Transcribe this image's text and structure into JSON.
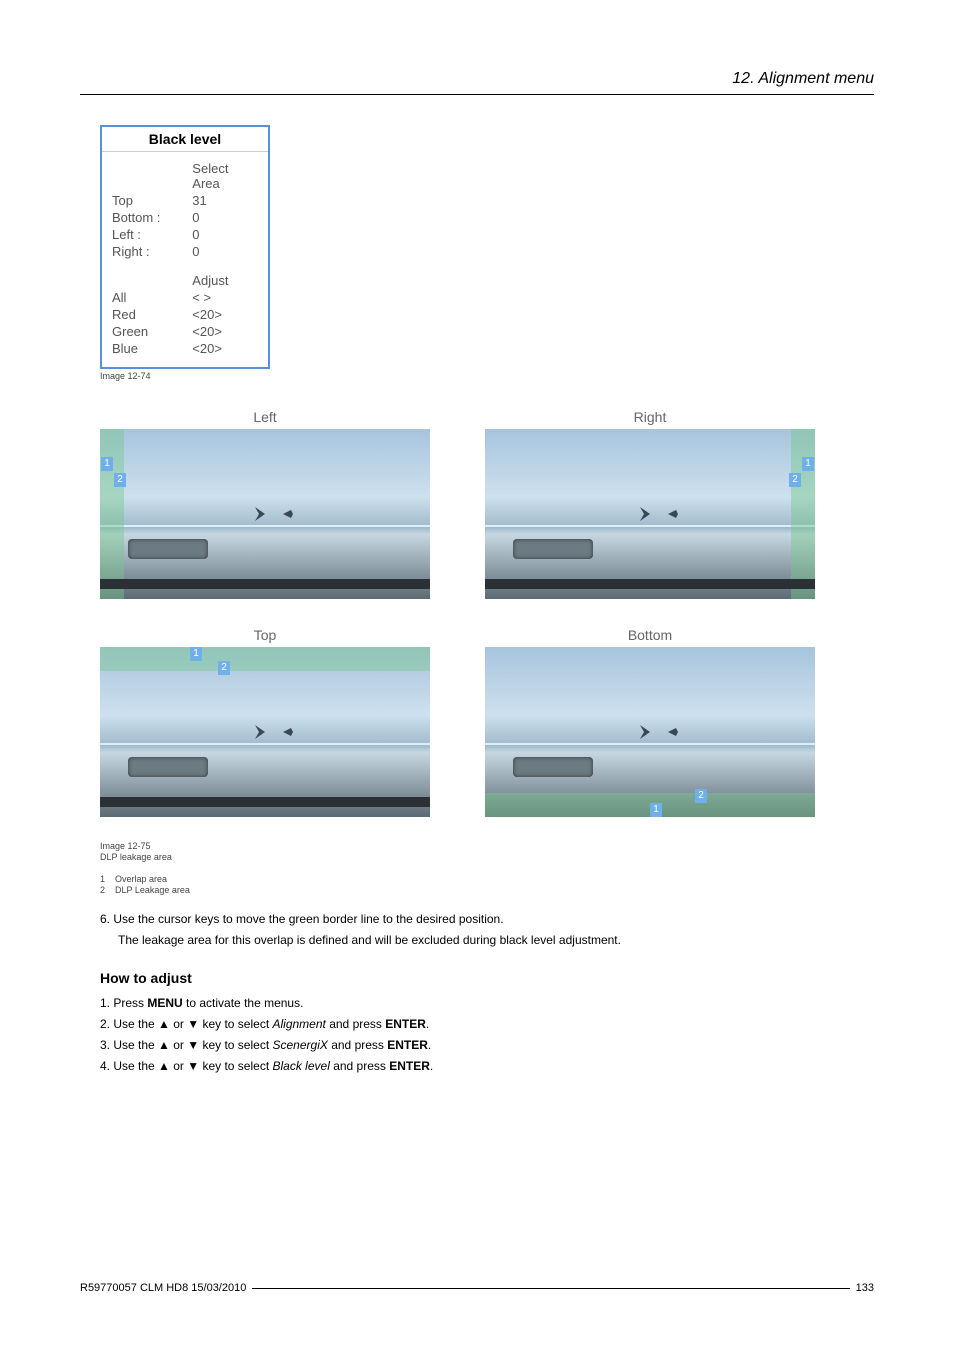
{
  "header": {
    "chapter_title": "12.  Alignment menu"
  },
  "panel": {
    "title": "Black level",
    "section1_heading": "Select Area",
    "rows1": [
      {
        "label": "Top",
        "value": "31"
      },
      {
        "label": "Bottom :",
        "value": "0"
      },
      {
        "label": "Left :",
        "value": "0"
      },
      {
        "label": "Right :",
        "value": "0"
      }
    ],
    "section2_heading": "Adjust",
    "rows2": [
      {
        "label": "All",
        "value": "< >"
      },
      {
        "label": "Red",
        "value": "<20>"
      },
      {
        "label": "Green",
        "value": "<20>"
      },
      {
        "label": "Blue",
        "value": "<20>"
      }
    ],
    "caption": "Image 12-74"
  },
  "figures": {
    "top_row": [
      {
        "label": "Left",
        "markers": [
          "1",
          "2"
        ],
        "side": "left"
      },
      {
        "label": "Right",
        "markers": [
          "1",
          "2"
        ],
        "side": "right"
      }
    ],
    "bottom_row": [
      {
        "label": "Top",
        "markers": [
          "1",
          "2"
        ],
        "side": "top"
      },
      {
        "label": "Bottom",
        "markers": [
          "2",
          "1"
        ],
        "side": "bottom"
      }
    ],
    "caption_id": "Image 12-75",
    "caption_text": "DLP leakage area",
    "legend": [
      {
        "num": "1",
        "text": "Overlap area"
      },
      {
        "num": "2",
        "text": "DLP Leakage area"
      }
    ]
  },
  "instruction6": {
    "line1": "6.  Use the cursor keys to move the green border line to the desired position.",
    "line2": "The leakage area for this overlap is defined and will be excluded during black level adjustment."
  },
  "howto_heading": "How to adjust",
  "steps": [
    {
      "pre": "1.  Press ",
      "b1": "MENU",
      "post": " to activate the menus."
    },
    {
      "pre": "2.  Use the ▲ or ▼ key to select ",
      "i": "Alignment",
      "mid": " and press ",
      "b1": "ENTER",
      "post": "."
    },
    {
      "pre": "3.  Use the ▲ or ▼ key to select ",
      "i": "ScenergiX",
      "mid": " and press ",
      "b1": "ENTER",
      "post": "."
    },
    {
      "pre": "4.  Use the ▲ or ▼ key to select ",
      "i": "Black level",
      "mid": " and press ",
      "b1": "ENTER",
      "post": "."
    }
  ],
  "footer": {
    "left": "R59770057  CLM HD8  15/03/2010",
    "right": "133"
  }
}
